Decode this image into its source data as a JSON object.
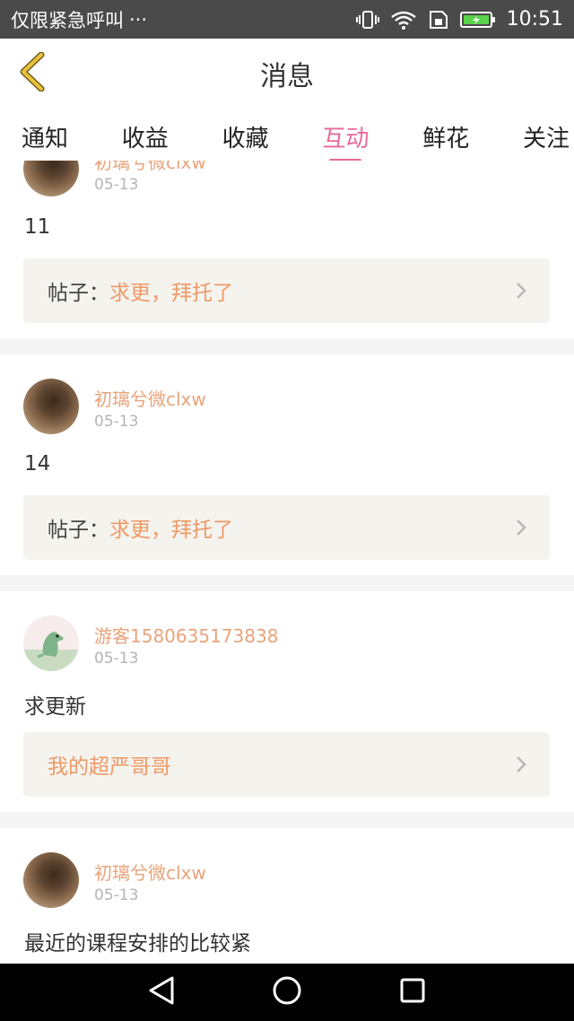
{
  "status_bar": {
    "left_text": "仅限紧急呼叫",
    "more": "···",
    "time": "10:51"
  },
  "header": {
    "title": "消息"
  },
  "tabs": [
    {
      "label": "通知"
    },
    {
      "label": "收益"
    },
    {
      "label": "收藏"
    },
    {
      "label": "互动",
      "active": true
    },
    {
      "label": "鲜花"
    },
    {
      "label": "关注"
    }
  ],
  "posts": [
    {
      "username": "初璃兮微clxw",
      "date": "05-13",
      "comment": "11",
      "ref_label": "帖子：",
      "ref_title": "求更，拜托了"
    },
    {
      "username": "初璃兮微clxw",
      "date": "05-13",
      "comment": "14",
      "ref_label": "帖子：",
      "ref_title": "求更，拜托了"
    },
    {
      "username": "游客1580635173838",
      "date": "05-13",
      "comment": "求更新",
      "ref_label": "",
      "ref_title": "我的超严哥哥"
    },
    {
      "username": "初璃兮微clxw",
      "date": "05-13",
      "comment": "最近的课程安排的比较紧"
    }
  ],
  "colors": {
    "accent_pink": "#e8699a",
    "username_orange": "#e9a37a",
    "ref_title_orange": "#ee9966",
    "back_icon_yellow": "#e8b923"
  },
  "icons": {
    "back": "chevron-left-icon",
    "ref_arrow": "chevron-right-icon",
    "nav_back": "triangle-back-icon",
    "nav_home": "circle-home-icon",
    "nav_recent": "square-recent-icon"
  }
}
